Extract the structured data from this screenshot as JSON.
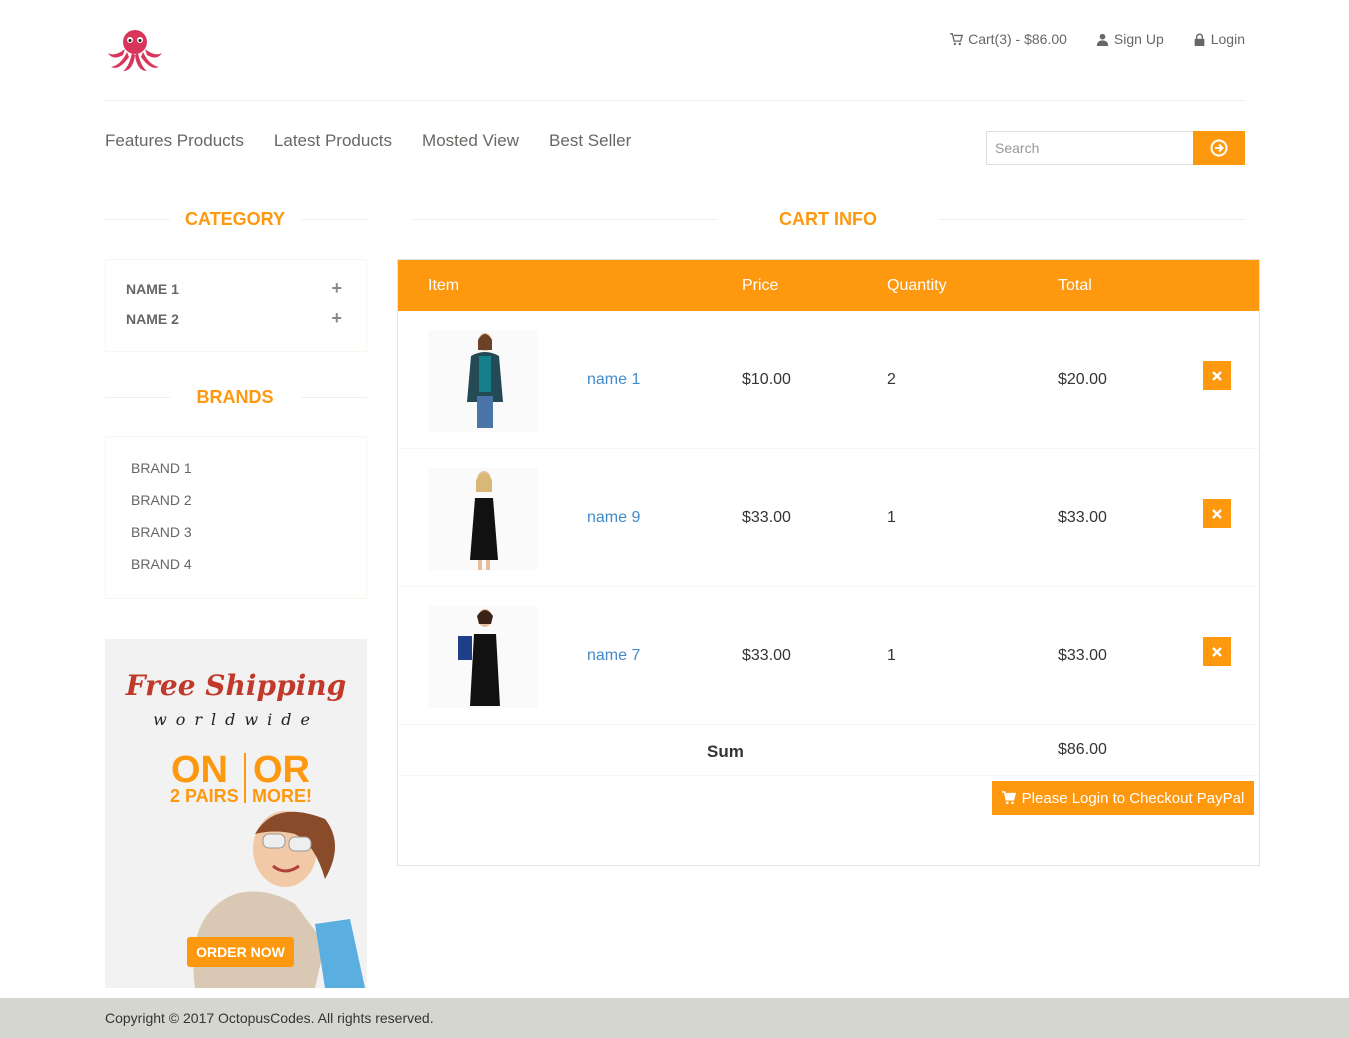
{
  "header": {
    "cart_link": "Cart(3) - $86.00",
    "signup_link": "Sign Up",
    "login_link": "Login"
  },
  "nav": {
    "items": [
      "Features Products",
      "Latest Products",
      "Mosted View",
      "Best Seller"
    ],
    "search_placeholder": "Search"
  },
  "sidebar": {
    "category_title": "CATEGORY",
    "categories": [
      "NAME 1",
      "NAME 2"
    ],
    "brands_title": "BRANDS",
    "brands": [
      "BRAND 1",
      "BRAND 2",
      "BRAND 3",
      "BRAND 4"
    ]
  },
  "promo": {
    "free_shipping": "Free Shipping",
    "worldwide": "worldwide",
    "on": "ON",
    "or": "OR",
    "pairs": "2 PAIRS",
    "more": "MORE!",
    "order_now": "ORDER NOW"
  },
  "cart": {
    "title": "CART INFO",
    "columns": [
      "Item",
      "Price",
      "Quantity",
      "Total"
    ],
    "rows": [
      {
        "name": "name 1",
        "price": "$10.00",
        "quantity": "2",
        "total": "$20.00"
      },
      {
        "name": "name 9",
        "price": "$33.00",
        "quantity": "1",
        "total": "$33.00"
      },
      {
        "name": "name 7",
        "price": "$33.00",
        "quantity": "1",
        "total": "$33.00"
      }
    ],
    "sum_label": "Sum",
    "sum_value": "$86.00",
    "checkout_label": "Please Login to Checkout PayPal"
  },
  "footer": {
    "copyright": "Copyright © 2017 OctopusCodes. All rights reserved."
  },
  "colors": {
    "accent": "#fe980f",
    "link": "#428bca",
    "footer_bg": "#d6d6d0"
  }
}
